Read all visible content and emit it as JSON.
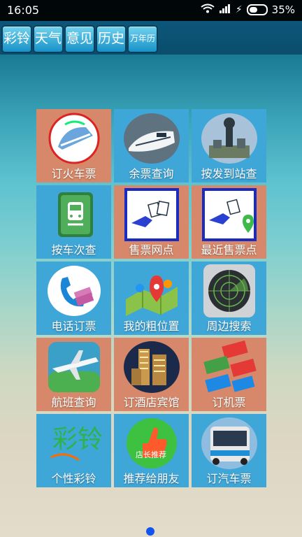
{
  "status_bar": {
    "time": "16:05",
    "battery": "35%",
    "signal": "wifi-signal-charging-icons"
  },
  "toolbar": {
    "buttons": [
      {
        "label": "彩铃"
      },
      {
        "label": "天气"
      },
      {
        "label": "意见"
      },
      {
        "label": "历史"
      },
      {
        "label": "万年历"
      }
    ]
  },
  "menu": {
    "items": [
      {
        "label": "订火车票",
        "icon": "train-ticket-icon"
      },
      {
        "label": "余票查询",
        "icon": "bullet-train-icon"
      },
      {
        "label": "按发到站查",
        "icon": "station-icon"
      },
      {
        "label": "按车次查",
        "icon": "train-number-icon"
      },
      {
        "label": "售票网点",
        "icon": "ticket-office-icon"
      },
      {
        "label": "最近售票点",
        "icon": "nearest-office-icon"
      },
      {
        "label": "电话订票",
        "icon": "phone-icon"
      },
      {
        "label": "我的粗位置",
        "icon": "location-map-icon"
      },
      {
        "label": "周边搜索",
        "icon": "radar-icon"
      },
      {
        "label": "航班查询",
        "icon": "airplane-icon"
      },
      {
        "label": "订酒店宾馆",
        "icon": "hotel-icon"
      },
      {
        "label": "订机票",
        "icon": "plane-tickets-icon"
      },
      {
        "label": "个性彩铃",
        "icon": "ringtone-icon",
        "icon_text": "彩铃"
      },
      {
        "label": "推荐给朋友",
        "icon": "thumbs-up-icon",
        "icon_text": "店长推荐"
      },
      {
        "label": "订汽车票",
        "icon": "bus-icon"
      }
    ]
  },
  "colors": {
    "cell_blue": "#3fa6d8",
    "cell_orange": "#e08a66",
    "page_indicator": "#1155ee"
  }
}
